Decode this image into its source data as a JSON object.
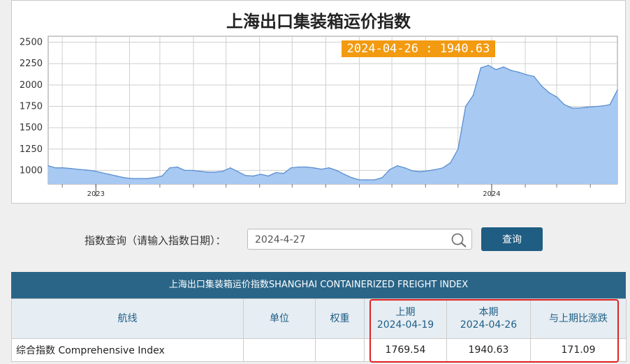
{
  "chart": {
    "title": "上海出口集装箱运价指数",
    "tooltip": "2024-04-26 : 1940.63"
  },
  "chart_data": {
    "type": "area",
    "title": "上海出口集装箱运价指数",
    "yticks": [
      1000,
      1250,
      1500,
      1750,
      2000,
      2250,
      2500
    ],
    "ylim": [
      840,
      2570
    ],
    "xticks": [
      "2023",
      "2024"
    ],
    "x": [
      "2022-11-18",
      "2022-11-25",
      "2022-12-02",
      "2022-12-09",
      "2022-12-16",
      "2022-12-23",
      "2022-12-30",
      "2023-01-06",
      "2023-01-13",
      "2023-01-20",
      "2023-01-27",
      "2023-02-03",
      "2023-02-10",
      "2023-02-17",
      "2023-02-24",
      "2023-03-03",
      "2023-03-10",
      "2023-03-17",
      "2023-03-24",
      "2023-03-31",
      "2023-04-07",
      "2023-04-14",
      "2023-04-21",
      "2023-04-28",
      "2023-05-05",
      "2023-05-12",
      "2023-05-19",
      "2023-05-26",
      "2023-06-02",
      "2023-06-09",
      "2023-06-16",
      "2023-06-23",
      "2023-06-30",
      "2023-07-07",
      "2023-07-14",
      "2023-07-21",
      "2023-07-28",
      "2023-08-04",
      "2023-08-11",
      "2023-08-18",
      "2023-08-25",
      "2023-09-01",
      "2023-09-08",
      "2023-09-15",
      "2023-09-22",
      "2023-09-29",
      "2023-10-06",
      "2023-10-13",
      "2023-10-20",
      "2023-10-27",
      "2023-11-03",
      "2023-11-10",
      "2023-11-17",
      "2023-11-24",
      "2023-12-01",
      "2023-12-08",
      "2023-12-15",
      "2023-12-22",
      "2023-12-29",
      "2024-01-05",
      "2024-01-12",
      "2024-01-19",
      "2024-01-26",
      "2024-02-02",
      "2024-02-09",
      "2024-02-16",
      "2024-02-23",
      "2024-03-01",
      "2024-03-08",
      "2024-03-15",
      "2024-03-22",
      "2024-03-29",
      "2024-04-03",
      "2024-04-12",
      "2024-04-19",
      "2024-04-26"
    ],
    "values": [
      1055,
      1030,
      1030,
      1022,
      1012,
      1005,
      995,
      975,
      955,
      935,
      915,
      905,
      905,
      905,
      915,
      935,
      1030,
      1040,
      1000,
      1000,
      990,
      980,
      980,
      990,
      1030,
      985,
      940,
      935,
      955,
      935,
      975,
      965,
      1030,
      1040,
      1040,
      1030,
      1015,
      1030,
      1000,
      955,
      915,
      890,
      890,
      890,
      915,
      1010,
      1055,
      1030,
      995,
      985,
      995,
      1010,
      1030,
      1090,
      1250,
      1750,
      1880,
      2200,
      2230,
      2180,
      2210,
      2170,
      2150,
      2120,
      2100,
      1990,
      1910,
      1860,
      1770,
      1730,
      1730,
      1740,
      1745,
      1755,
      1769.54,
      1940.63
    ],
    "grid": true,
    "fill_color": "#a7c9f2",
    "line_color": "#5b8fd0"
  },
  "query": {
    "label": "指数查询（请输入指数日期）：",
    "value": "2024-4-27",
    "button": "查询"
  },
  "table": {
    "caption": "上海出口集装箱运价指数SHANGHAI CONTAINERIZED FREIGHT INDEX",
    "headers": {
      "route": "航线",
      "unit": "单位",
      "weight": "权重",
      "prev_label": "上期",
      "prev_date": "2024-04-19",
      "curr_label": "本期",
      "curr_date": "2024-04-26",
      "change": "与上期比涨跌"
    },
    "rows": [
      {
        "route": "综合指数 Comprehensive Index",
        "unit": "",
        "weight": "",
        "prev": "1769.54",
        "curr": "1940.63",
        "change": "171.09"
      }
    ]
  },
  "colors": {
    "accent": "#2a6588",
    "button": "#1f5d82",
    "tooltip": "#f29a10",
    "highlight": "#e02020"
  }
}
